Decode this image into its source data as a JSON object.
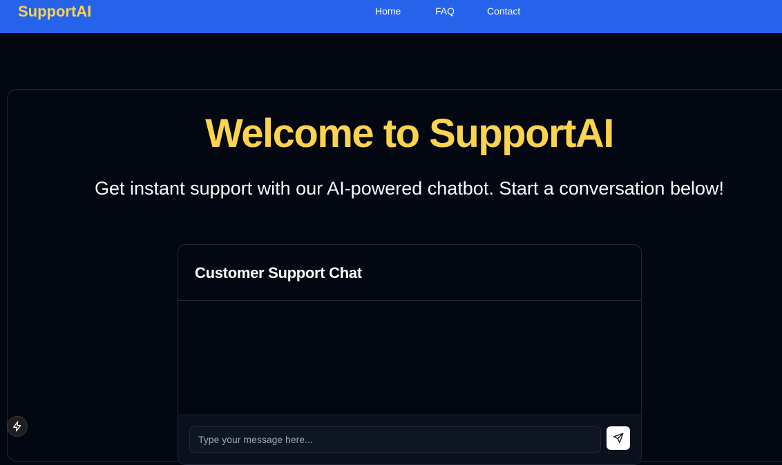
{
  "header": {
    "brand": "SupportAI",
    "nav": {
      "home": "Home",
      "faq": "FAQ",
      "contact": "Contact"
    }
  },
  "hero": {
    "title": "Welcome to SupportAI",
    "subtitle": "Get instant support with our AI-powered chatbot. Start a conversation below!"
  },
  "chat": {
    "title": "Customer Support Chat",
    "messages": [],
    "input": {
      "value": "",
      "placeholder": "Type your message here..."
    },
    "send_icon": "send-icon"
  },
  "dev_badge_icon": "lightning-icon",
  "colors": {
    "navbar": "#2563eb",
    "accent_yellow": "#fcd34d",
    "background": "#030712",
    "border": "#1f2937"
  }
}
